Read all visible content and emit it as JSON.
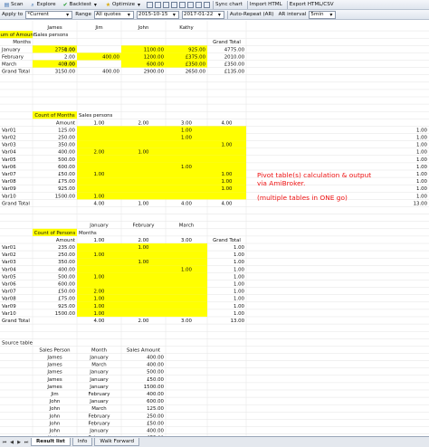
{
  "toolbar": {
    "scan": "Scan",
    "explore": "Explore",
    "backtest": "Backtest",
    "optimize": "Optimize",
    "sync_chart": "Sync chart",
    "import_html": "Import HTML",
    "export_html_csv": "Export HTML/CSV",
    "apply_to_label": "Apply to",
    "apply_to_value": "*Current",
    "range_label": "Range",
    "range_value": "All quotes",
    "from_date": "2015-10-15",
    "to_date": "2017-01-22",
    "auto_repeat_label": "Auto-Repeat (AR)",
    "ar_interval_label": "AR interval",
    "ar_interval_value": "5min"
  },
  "annotation": {
    "line1": "Pivot table(s) calculation & output",
    "line2": "via AmiBroker.",
    "line3": "(multiple tables in ONE go)"
  },
  "tabs": [
    "Result list",
    "Info",
    "Walk Forward"
  ],
  "accent": {
    "highlight": "#ffff00",
    "annotation": "#ee1111"
  },
  "table1": {
    "row_a": [
      "",
      "James",
      "Jim",
      "John",
      "Kathy",
      ""
    ],
    "row_b": [
      "Sum of Amount",
      "Sales persons",
      "",
      "",
      "",
      ""
    ],
    "header": [
      "Months",
      "",
      "",
      "",
      "",
      "Grand Total"
    ],
    "rows": [
      [
        "January",
        "1.00",
        "2750.00",
        "",
        "1100.00",
        "925.00",
        "4775.00"
      ],
      [
        "February",
        "2.00",
        "",
        "400.00",
        "1200.00",
        "£375.00",
        "2010.00"
      ],
      [
        "March",
        "3.00",
        "400.00",
        "",
        "600.00",
        "£350.00",
        "£350.00"
      ],
      [
        "Grand Total",
        "",
        "3150.00",
        "400.00",
        "2900.00",
        "2650.00",
        "£135.00"
      ]
    ],
    "highlight": [
      [
        0,
        2
      ],
      [
        0,
        4
      ],
      [
        0,
        5
      ],
      [
        1,
        3
      ],
      [
        1,
        4
      ],
      [
        1,
        5
      ],
      [
        2,
        2
      ],
      [
        2,
        4
      ],
      [
        2,
        5
      ]
    ]
  },
  "table2": {
    "title": "Count of Months",
    "col_label": "Sales persons",
    "header": [
      "",
      "Amount",
      "1.00",
      "2.00",
      "3.00",
      "4.00",
      ""
    ],
    "rows": [
      [
        "Var01",
        "125.00",
        "",
        "",
        "1.00",
        "",
        "1.00"
      ],
      [
        "Var02",
        "250.00",
        "",
        "",
        "1.00",
        "",
        "1.00"
      ],
      [
        "Var03",
        "350.00",
        "",
        "",
        "",
        "1.00",
        "1.00"
      ],
      [
        "Var04",
        "400.00",
        "2.00",
        "1.00",
        "",
        "",
        "1.00"
      ],
      [
        "Var05",
        "500.00",
        "",
        "",
        "",
        "",
        "1.00"
      ],
      [
        "Var06",
        "600.00",
        "",
        "",
        "1.00",
        "",
        "1.00"
      ],
      [
        "Var07",
        "£50.00",
        "1.00",
        "",
        "",
        "1.00",
        "1.00"
      ],
      [
        "Var08",
        "£75.00",
        "",
        "",
        "",
        "1.00",
        "1.00"
      ],
      [
        "Var09",
        "925.00",
        "",
        "",
        "",
        "1.00",
        "1.00"
      ],
      [
        "Var10",
        "1500.00",
        "1.00",
        "",
        "",
        "",
        "1.00"
      ],
      [
        "Grand Total",
        "",
        "4.00",
        "1.00",
        "4.00",
        "4.00",
        "13.00"
      ]
    ]
  },
  "table3": {
    "top": [
      "",
      "",
      "January",
      "February",
      "March",
      ""
    ],
    "title": "Count of Persons",
    "col_label": "Months",
    "header": [
      "",
      "Amount",
      "1.00",
      "2.00",
      "3.00",
      "Grand Total"
    ],
    "rows": [
      [
        "Var01",
        "235.00",
        "",
        "1.00",
        "",
        "1.00"
      ],
      [
        "Var02",
        "250.00",
        "1.00",
        "",
        "",
        "1.00"
      ],
      [
        "Var03",
        "350.00",
        "",
        "1.00",
        "",
        "1.00"
      ],
      [
        "Var04",
        "400.00",
        "",
        "",
        "1.00",
        "1.00"
      ],
      [
        "Var05",
        "500.00",
        "1.00",
        "",
        "",
        "1.00"
      ],
      [
        "Var06",
        "600.00",
        "",
        "",
        "",
        "1.00"
      ],
      [
        "Var07",
        "£50.00",
        "2.00",
        "",
        "",
        "1.00"
      ],
      [
        "Var08",
        "£75.00",
        "1.00",
        "",
        "",
        "1.00"
      ],
      [
        "Var09",
        "925.00",
        "1.00",
        "",
        "",
        "1.00"
      ],
      [
        "Var10",
        "1500.00",
        "1.00",
        "",
        "",
        "1.00"
      ],
      [
        "Grand Total",
        "",
        "4.00",
        "2.00",
        "3.00",
        "13.00"
      ]
    ]
  },
  "source": {
    "title": "Source table",
    "header": [
      "Sales Person",
      "Month",
      "Sales Amount"
    ],
    "rows": [
      [
        "James",
        "January",
        "400.00"
      ],
      [
        "James",
        "March",
        "400.00"
      ],
      [
        "James",
        "January",
        "500.00"
      ],
      [
        "James",
        "January",
        "£50.00"
      ],
      [
        "James",
        "January",
        "1500.00"
      ],
      [
        "Jim",
        "February",
        "400.00"
      ],
      [
        "John",
        "January",
        "600.00"
      ],
      [
        "John",
        "March",
        "125.00"
      ],
      [
        "John",
        "February",
        "250.00"
      ],
      [
        "John",
        "February",
        "£50.00"
      ],
      [
        "John",
        "January",
        "400.00"
      ],
      [
        "Kathy",
        "February",
        "£75.00"
      ],
      [
        "Kathy",
        "January",
        "925.00"
      ],
      [
        "Kathy",
        "March",
        "350.00"
      ]
    ]
  }
}
